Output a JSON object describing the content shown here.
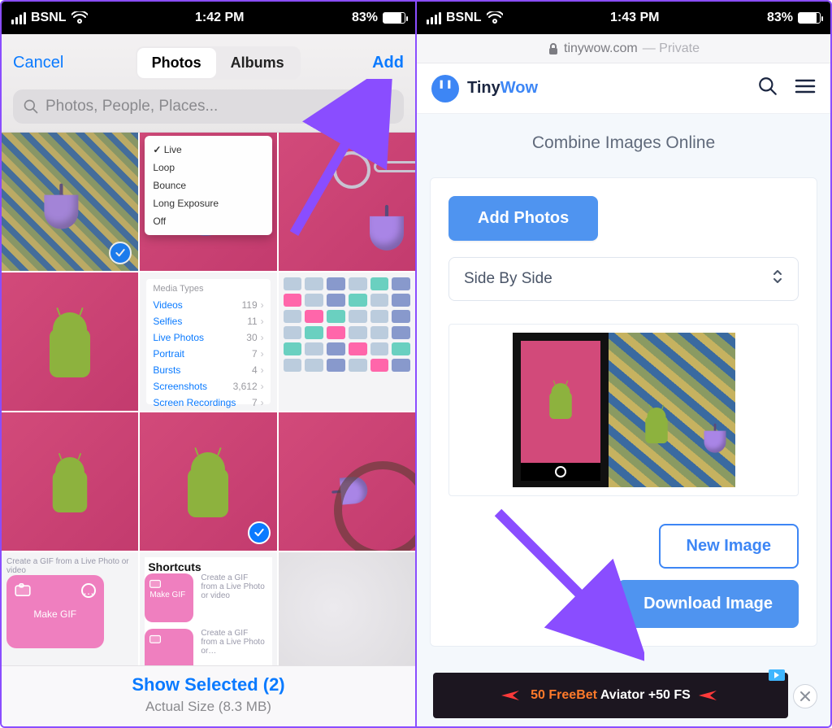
{
  "left": {
    "status": {
      "carrier": "BSNL",
      "time": "1:42 PM",
      "battery": "83%"
    },
    "picker": {
      "cancel": "Cancel",
      "add": "Add",
      "segments": {
        "photos": "Photos",
        "albums": "Albums"
      },
      "search_placeholder": "Photos, People, Places...",
      "context_menu": [
        "Live",
        "Loop",
        "Bounce",
        "Long Exposure",
        "Off"
      ],
      "media_types_header": "Media Types",
      "media_types": [
        {
          "label": "Videos",
          "count": "119"
        },
        {
          "label": "Selfies",
          "count": "11"
        },
        {
          "label": "Live Photos",
          "count": "30"
        },
        {
          "label": "Portrait",
          "count": "7"
        },
        {
          "label": "Bursts",
          "count": "4"
        },
        {
          "label": "Screenshots",
          "count": "3,612"
        },
        {
          "label": "Screen Recordings",
          "count": "7"
        }
      ],
      "shortcuts": {
        "hint": "Create a GIF from a Live Photo or video",
        "title": "Shortcuts",
        "big_label": "Make GIF",
        "small_label": "Make GIF",
        "caption1": "Create a GIF from a Live Photo or video",
        "caption2": "Create a GIF from a Live Photo or…"
      },
      "footer": {
        "selected": "Show Selected (2)",
        "size": "Actual Size (8.3 MB)"
      }
    }
  },
  "right": {
    "status": {
      "carrier": "BSNL",
      "time": "1:43 PM",
      "battery": "83%"
    },
    "safari": {
      "domain": "tinywow.com",
      "mode": "— Private"
    },
    "brand": {
      "tiny": "Tiny",
      "wow": "Wow",
      "logo": "╹╹"
    },
    "page": {
      "subtitle": "Combine Images Online",
      "add_photos": "Add Photos",
      "mode_select": "Side By Side",
      "new_image": "New Image",
      "download": "Download Image"
    },
    "ad": {
      "freebet": "50 FreeBet",
      "rest": " Aviator +50 FS"
    }
  }
}
